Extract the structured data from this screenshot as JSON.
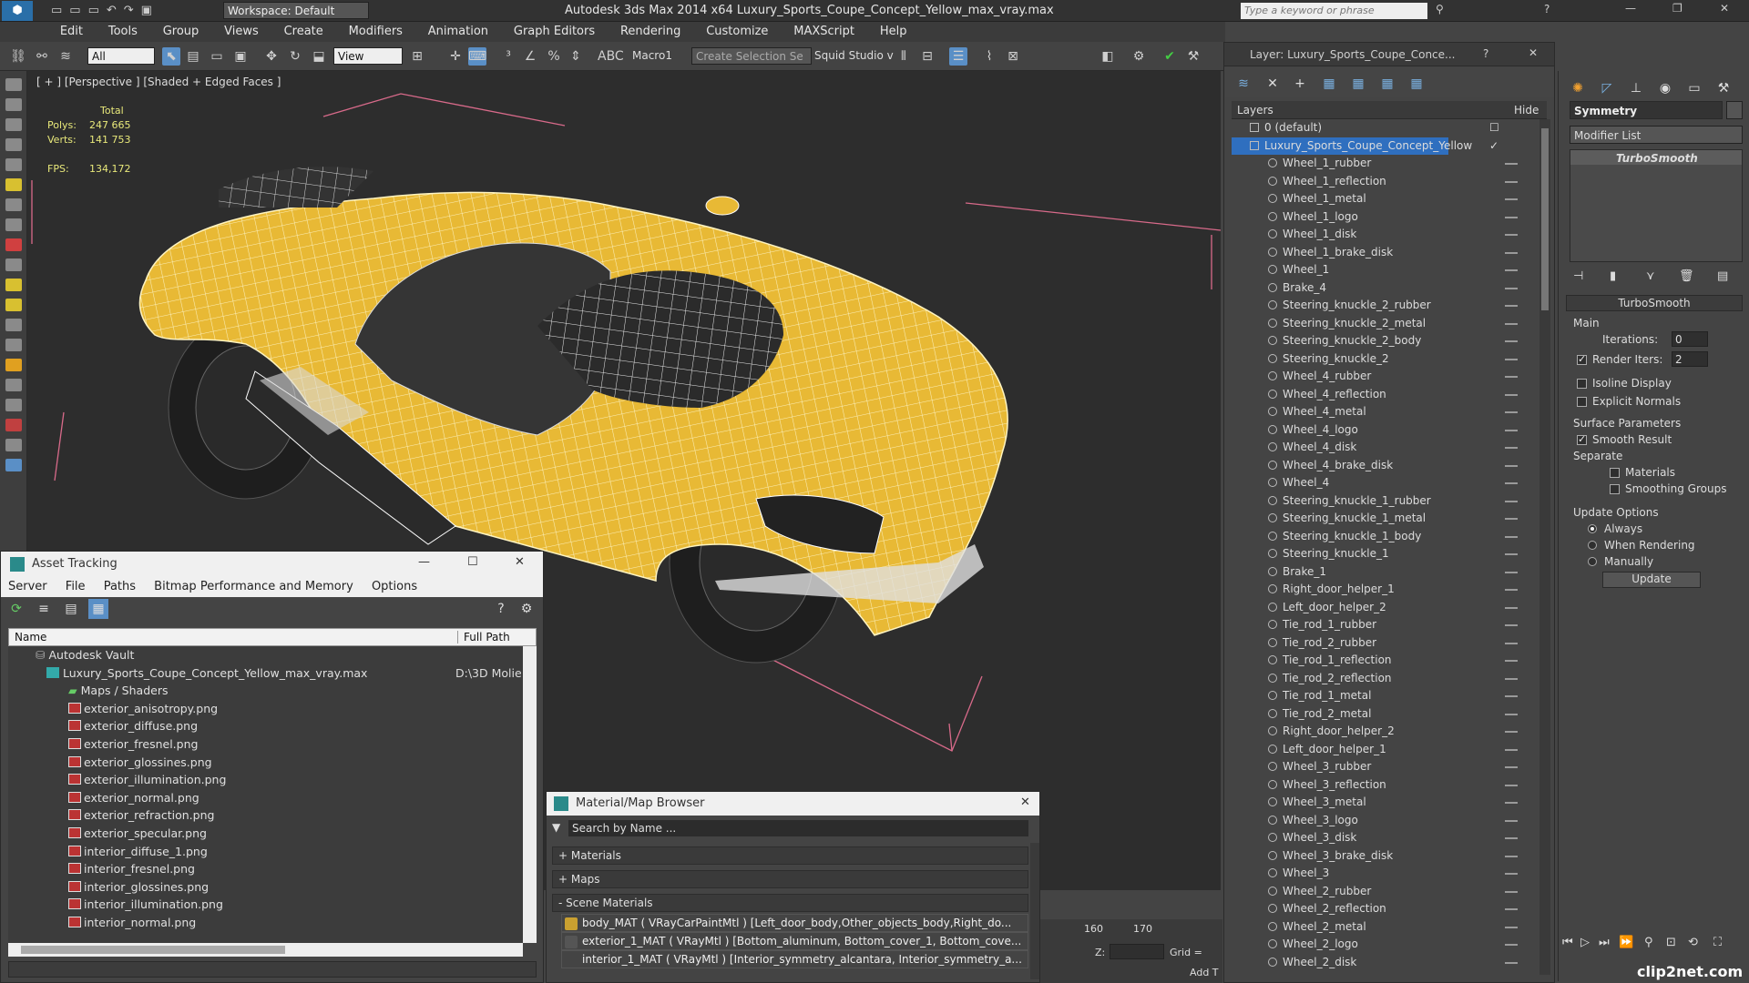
{
  "app": {
    "title": "Autodesk 3ds Max  2014 x64     Luxury_Sports_Coupe_Concept_Yellow_max_vray.max",
    "workspace": "Workspace: Default",
    "search_placeholder": "Type a keyword or phrase"
  },
  "menu": [
    "Edit",
    "Tools",
    "Group",
    "Views",
    "Create",
    "Modifiers",
    "Animation",
    "Graph Editors",
    "Rendering",
    "Customize",
    "MAXScript",
    "Help"
  ],
  "toolbar": {
    "filter": "All",
    "view": "View",
    "macro": "Macro1",
    "selection_set": "Create Selection Se",
    "squid": "Squid Studio v"
  },
  "viewport": {
    "label": "[ + ] [Perspective ] [Shaded + Edged Faces ]",
    "stats_header": "Total",
    "polys_label": "Polys:",
    "polys": "247 665",
    "verts_label": "Verts:",
    "verts": "141 753",
    "fps_label": "FPS:",
    "fps": "134,172"
  },
  "layers": {
    "title": "Layer: Luxury_Sports_Coupe_Conce...",
    "header": "Layers",
    "hide_header": "Hide",
    "items": [
      "0 (default)",
      "Luxury_Sports_Coupe_Concept_Yellow",
      "Wheel_1_rubber",
      "Wheel_1_reflection",
      "Wheel_1_metal",
      "Wheel_1_logo",
      "Wheel_1_disk",
      "Wheel_1_brake_disk",
      "Wheel_1",
      "Brake_4",
      "Steering_knuckle_2_rubber",
      "Steering_knuckle_2_metal",
      "Steering_knuckle_2_body",
      "Steering_knuckle_2",
      "Wheel_4_rubber",
      "Wheel_4_reflection",
      "Wheel_4_metal",
      "Wheel_4_logo",
      "Wheel_4_disk",
      "Wheel_4_brake_disk",
      "Wheel_4",
      "Steering_knuckle_1_rubber",
      "Steering_knuckle_1_metal",
      "Steering_knuckle_1_body",
      "Steering_knuckle_1",
      "Brake_1",
      "Right_door_helper_1",
      "Left_door_helper_2",
      "Tie_rod_1_rubber",
      "Tie_rod_2_rubber",
      "Tie_rod_1_reflection",
      "Tie_rod_2_reflection",
      "Tie_rod_1_metal",
      "Tie_rod_2_metal",
      "Right_door_helper_2",
      "Left_door_helper_1",
      "Wheel_3_rubber",
      "Wheel_3_reflection",
      "Wheel_3_metal",
      "Wheel_3_logo",
      "Wheel_3_disk",
      "Wheel_3_brake_disk",
      "Wheel_3",
      "Wheel_2_rubber",
      "Wheel_2_reflection",
      "Wheel_2_metal",
      "Wheel_2_logo",
      "Wheel_2_disk"
    ]
  },
  "command_panel": {
    "object_name": "Symmetry",
    "modifier_list": "Modifier List",
    "stack_item": "TurboSmooth",
    "rollout": "TurboSmooth",
    "main": "Main",
    "iterations_label": "Iterations:",
    "iterations": "0",
    "render_iters_label": "Render Iters:",
    "render_iters": "2",
    "isoline": "Isoline Display",
    "explicit": "Explicit Normals",
    "surface_params": "Surface Parameters",
    "smooth_result": "Smooth Result",
    "separate": "Separate",
    "materials": "Materials",
    "smoothing_groups": "Smoothing Groups",
    "update_options": "Update Options",
    "always": "Always",
    "when_rendering": "When Rendering",
    "manually": "Manually",
    "update": "Update"
  },
  "asset_tracking": {
    "title": "Asset Tracking",
    "menu": [
      "Server",
      "File",
      "Paths",
      "Bitmap Performance and Memory",
      "Options"
    ],
    "col_name": "Name",
    "col_path": "Full Path",
    "vault": "Autodesk Vault",
    "file": "Luxury_Sports_Coupe_Concept_Yellow_max_vray.max",
    "file_path": "D:\\3D Molie",
    "maps": "Maps / Shaders",
    "items": [
      "exterior_anisotropy.png",
      "exterior_diffuse.png",
      "exterior_fresnel.png",
      "exterior_glossines.png",
      "exterior_illumination.png",
      "exterior_normal.png",
      "exterior_refraction.png",
      "exterior_specular.png",
      "interior_diffuse_1.png",
      "interior_fresnel.png",
      "interior_glossines.png",
      "interior_illumination.png",
      "interior_normal.png"
    ]
  },
  "material_browser": {
    "title": "Material/Map Browser",
    "search": "Search by Name ...",
    "materials": "+ Materials",
    "maps": "+ Maps",
    "scene": "- Scene Materials",
    "rows": [
      "body_MAT  ( VRayCarPaintMtl ) [Left_door_body,Other_objects_body,Right_do...",
      "exterior_1_MAT  ( VRayMtl ) [Bottom_aluminum, Bottom_cover_1, Bottom_cove...",
      "interior_1_MAT  ( VRayMtl ) [Interior_symmetry_alcantara, Interior_symmetry_a..."
    ]
  },
  "timeline": {
    "t160": "160",
    "t170": "170",
    "z_label": "Z:",
    "grid": "Grid =",
    "add": "Add T"
  },
  "watermark": "clip2net.com"
}
